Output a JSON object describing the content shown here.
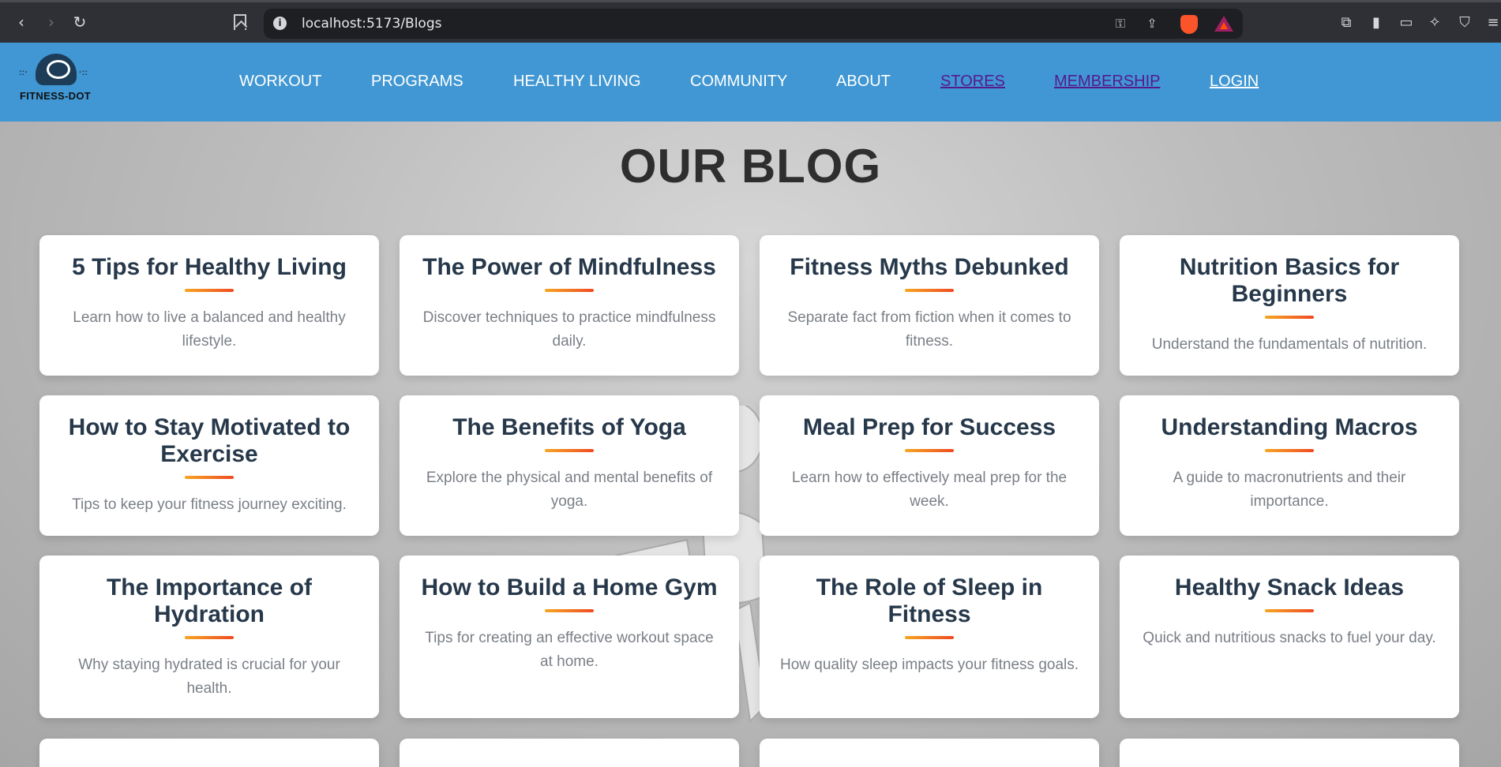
{
  "browser": {
    "url": "localhost:5173/Blogs"
  },
  "site": {
    "logo_text": "FITNESS-DOT",
    "nav": [
      {
        "label": "WORKOUT"
      },
      {
        "label": "PROGRAMS"
      },
      {
        "label": "HEALTHY LIVING"
      },
      {
        "label": "COMMUNITY"
      },
      {
        "label": "ABOUT"
      },
      {
        "label": "STORES"
      },
      {
        "label": "MEMBERSHIP"
      },
      {
        "label": "LOGIN"
      }
    ],
    "colors": {
      "header": "#4097d3",
      "visited_link": "#551a8b",
      "accent_bar_start": "#f5a623",
      "accent_bar_end": "#f04b23"
    }
  },
  "page_title": "OUR BLOG",
  "posts": [
    {
      "title": "5 Tips for Healthy Living",
      "summary": "Learn how to live a balanced and healthy lifestyle."
    },
    {
      "title": "The Power of Mindfulness",
      "summary": "Discover techniques to practice mindfulness daily."
    },
    {
      "title": "Fitness Myths Debunked",
      "summary": "Separate fact from fiction when it comes to fitness."
    },
    {
      "title": "Nutrition Basics for Beginners",
      "summary": "Understand the fundamentals of nutrition."
    },
    {
      "title": "How to Stay Motivated to Exercise",
      "summary": "Tips to keep your fitness journey exciting."
    },
    {
      "title": "The Benefits of Yoga",
      "summary": "Explore the physical and mental benefits of yoga."
    },
    {
      "title": "Meal Prep for Success",
      "summary": "Learn how to effectively meal prep for the week."
    },
    {
      "title": "Understanding Macros",
      "summary": "A guide to macronutrients and their importance."
    },
    {
      "title": "The Importance of Hydration",
      "summary": "Why staying hydrated is crucial for your health."
    },
    {
      "title": "How to Build a Home Gym",
      "summary": "Tips for creating an effective workout space at home."
    },
    {
      "title": "The Role of Sleep in Fitness",
      "summary": "How quality sleep impacts your fitness goals."
    },
    {
      "title": "Healthy Snack Ideas",
      "summary": "Quick and nutritious snacks to fuel your day."
    }
  ]
}
